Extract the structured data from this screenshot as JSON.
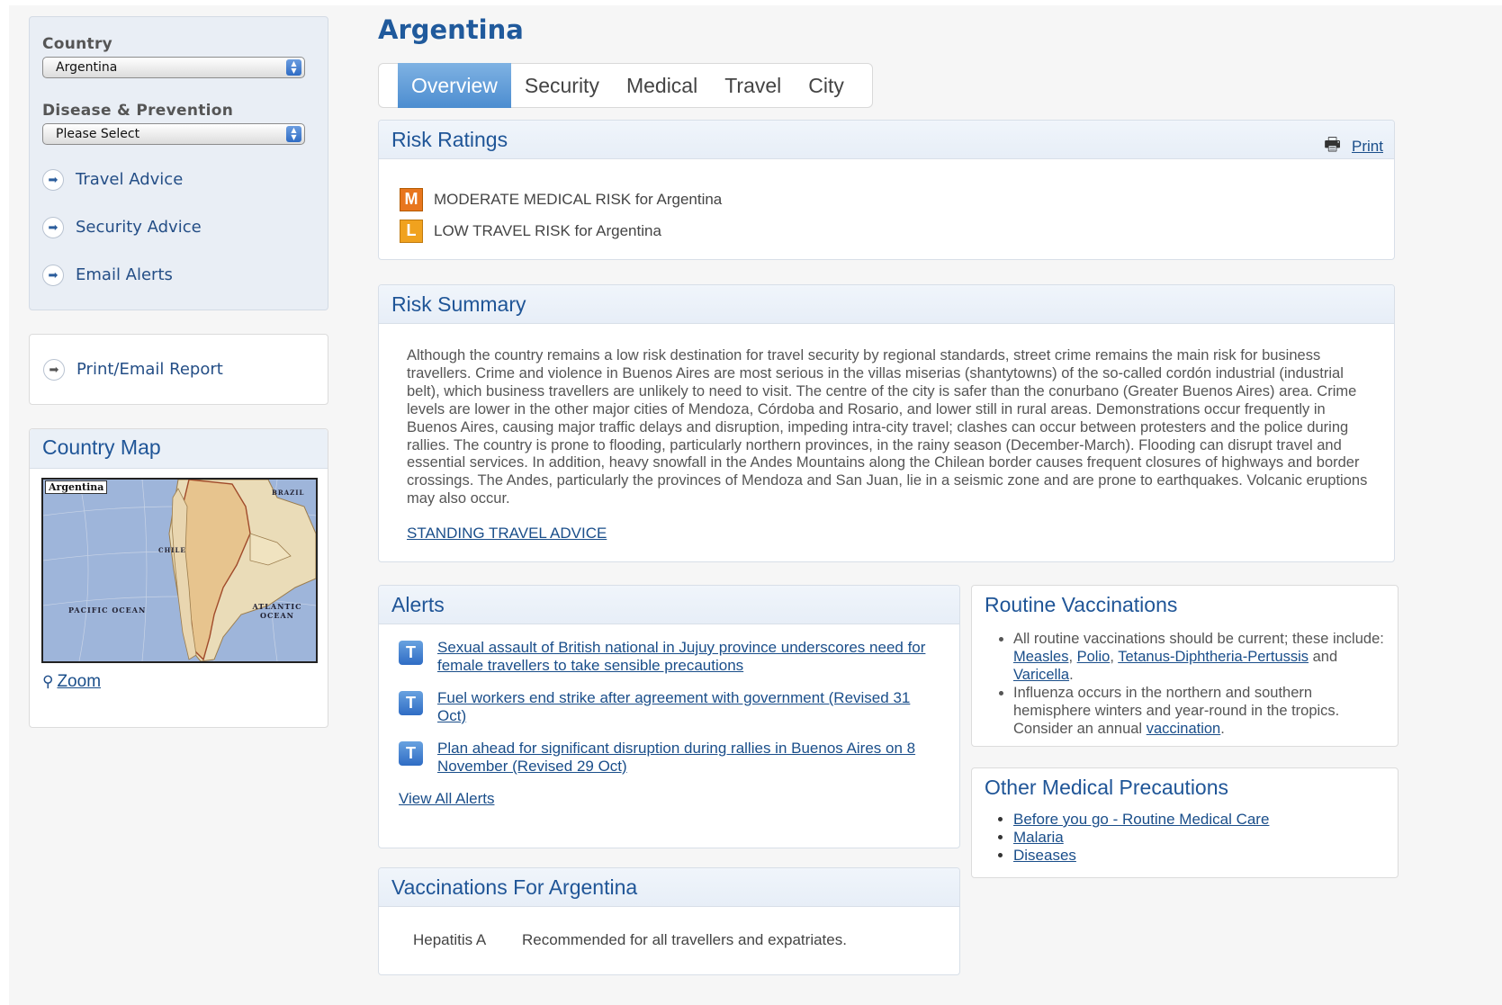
{
  "sidebar": {
    "country_label": "Country",
    "country_value": "Argentina",
    "disease_label": "Disease & Prevention",
    "disease_value": "Please Select",
    "links": [
      {
        "label": "Travel Advice",
        "icon": "arrow-right-circle-icon"
      },
      {
        "label": "Security Advice",
        "icon": "arrow-right-circle-icon"
      },
      {
        "label": "Email Alerts",
        "icon": "arrow-right-circle-icon"
      }
    ],
    "report_label": "Print/Email Report",
    "map_title": "Country Map",
    "map_tag": "Argentina",
    "map_labels": {
      "pacific": "PACIFIC OCEAN",
      "atlantic": "ATLANTIC OCEAN",
      "chile": "CHILE",
      "brazil": "BRAZIL"
    },
    "zoom_label": "Zoom"
  },
  "main": {
    "title": "Argentina",
    "tabs": [
      "Overview",
      "Security",
      "Medical",
      "Travel",
      "City"
    ],
    "active_tab": "Overview",
    "risk_ratings": {
      "title": "Risk Ratings",
      "print_label": "Print",
      "items": [
        {
          "badge": "M",
          "text": "MODERATE MEDICAL RISK for Argentina",
          "color": "#e8761e"
        },
        {
          "badge": "L",
          "text": "LOW TRAVEL RISK for Argentina",
          "color": "#f0a21e"
        }
      ]
    },
    "risk_summary": {
      "title": "Risk Summary",
      "text": "Although the country remains a low risk destination for travel security by regional standards, street crime remains the main risk for business travellers. Crime and violence in Buenos Aires are most serious in the villas miserias (shantytowns) of the so-called cordón industrial (industrial belt), which business travellers are unlikely to need to visit. The centre of the city is safer than the conurbano (Greater Buenos Aires) area. Crime levels are lower in the other major cities of Mendoza, Córdoba and Rosario, and lower still in rural areas. Demonstrations occur frequently in Buenos Aires, causing major traffic delays and disruption, impeding intra-city travel; clashes can occur between protesters and the police during rallies. The country is prone to flooding, particularly northern provinces, in the rainy season (December-March). Flooding can disrupt travel and essential services. In addition, heavy snowfall in the Andes Mountains along the Chilean border causes frequent closures of highways and border crossings. The Andes, particularly the provinces of Mendoza and San Juan, lie in a seismic zone and are prone to earthquakes. Volcanic eruptions may also occur.",
      "link": "STANDING TRAVEL ADVICE"
    },
    "alerts": {
      "title": "Alerts",
      "items": [
        {
          "badge": "T",
          "text": "Sexual assault of British national in Jujuy province underscores need for female travellers to take sensible precautions"
        },
        {
          "badge": "T",
          "text": "Fuel workers end strike after agreement with government (Revised 31 Oct)"
        },
        {
          "badge": "T",
          "text": "Plan ahead for significant disruption during rallies in Buenos Aires on 8 November (Revised 29 Oct)"
        }
      ],
      "view_all": "View All Alerts"
    },
    "vaccinations": {
      "title": "Vaccinations For Argentina",
      "rows": [
        {
          "name": "Hepatitis A",
          "text": "Recommended for all travellers and expatriates."
        }
      ]
    },
    "routine": {
      "title": "Routine Vaccinations",
      "item1_text": "All routine vaccinations should be current; these include: ",
      "links": [
        "Measles",
        "Polio",
        "Tetanus-Diphtheria-Pertussis",
        "Varicella"
      ],
      "sep": ", ",
      "and": " and ",
      "end": ".",
      "item2_text": "Influenza occurs in the northern and southern hemisphere winters and year-round in the tropics. Consider an annual ",
      "item2_link": "vaccination",
      "item2_end": "."
    },
    "other": {
      "title": "Other Medical Precautions",
      "links": [
        "Before you go - Routine Medical Care",
        "Malaria",
        "Diseases"
      ]
    }
  }
}
